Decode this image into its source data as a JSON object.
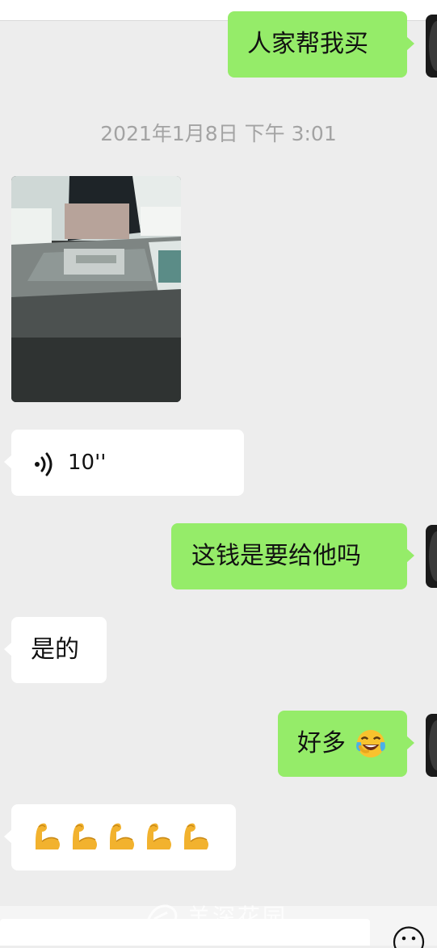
{
  "messages": {
    "m1": {
      "text": "人家帮我买"
    },
    "timestamp": "2021年1月8日 下午 3:01",
    "voice": {
      "duration": "10''"
    },
    "m2": {
      "text": "这钱是要给他吗"
    },
    "m3": {
      "text": "是的"
    },
    "m4": {
      "text": "好多"
    }
  },
  "icons": {
    "voice": "voice-wave-icon",
    "laugh": "laughing-tears-emoji",
    "bicep": "flexed-biceps-emoji"
  },
  "watermark": {
    "text": "羊深花园"
  },
  "colors": {
    "background": "#ededed",
    "outgoing_bubble": "#95ec69",
    "incoming_bubble": "#ffffff",
    "timestamp": "#a3a3a3"
  }
}
